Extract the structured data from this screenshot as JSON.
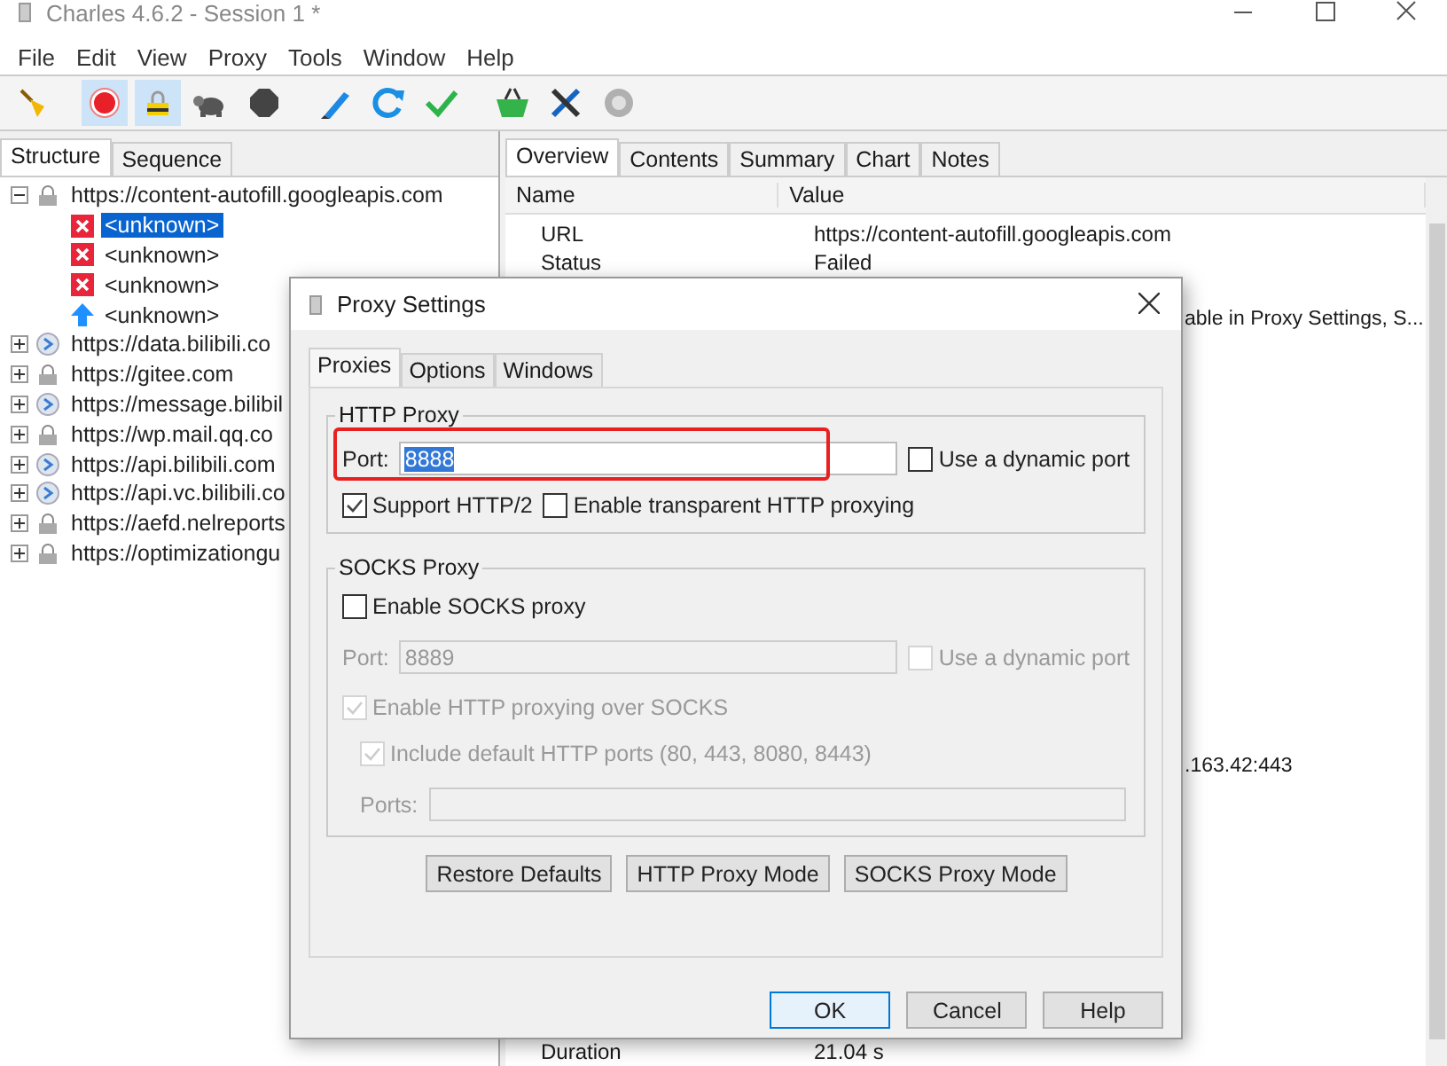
{
  "window": {
    "title": "Charles 4.6.2 - Session 1 *"
  },
  "menu": [
    "File",
    "Edit",
    "View",
    "Proxy",
    "Tools",
    "Window",
    "Help"
  ],
  "toolbar": [
    {
      "kind": "broom",
      "on": false
    },
    {
      "kind": "record",
      "on": true
    },
    {
      "kind": "throttle",
      "on": true
    },
    {
      "kind": "turtle",
      "on": false
    },
    {
      "kind": "stop",
      "on": false
    },
    {
      "kind": "pen",
      "on": false
    },
    {
      "kind": "refresh",
      "on": false
    },
    {
      "kind": "check",
      "on": false
    },
    {
      "kind": "basket",
      "on": false
    },
    {
      "kind": "tools",
      "on": false
    },
    {
      "kind": "gear",
      "on": false
    }
  ],
  "left_tabs": [
    {
      "label": "Structure",
      "selected": true
    },
    {
      "label": "Sequence",
      "selected": false
    }
  ],
  "tree": [
    {
      "label": "https://content-autofill.googleapis.com",
      "kind": "lock",
      "expanded": true,
      "children": [
        {
          "label": "<unknown>",
          "kind": "error",
          "selected": true
        },
        {
          "label": "<unknown>",
          "kind": "error",
          "selected": false
        },
        {
          "label": "<unknown>",
          "kind": "error",
          "selected": false
        },
        {
          "label": "<unknown>",
          "kind": "upload",
          "selected": false
        }
      ]
    },
    {
      "label": "https://data.bilibili.co",
      "kind": "globe",
      "expanded": false
    },
    {
      "label": "https://gitee.com",
      "kind": "lock",
      "expanded": false
    },
    {
      "label": "https://message.bilibil",
      "kind": "globe",
      "expanded": false
    },
    {
      "label": "https://wp.mail.qq.co",
      "kind": "lock",
      "expanded": false
    },
    {
      "label": "https://api.bilibili.com",
      "kind": "globe",
      "expanded": false
    },
    {
      "label": "https://api.vc.bilibili.co",
      "kind": "globe",
      "expanded": false
    },
    {
      "label": "https://aefd.nelreports",
      "kind": "lock",
      "expanded": false
    },
    {
      "label": "https://optimizationgu",
      "kind": "lock",
      "expanded": false
    }
  ],
  "right_tabs": [
    {
      "label": "Overview",
      "selected": true
    },
    {
      "label": "Contents",
      "selected": false
    },
    {
      "label": "Summary",
      "selected": false
    },
    {
      "label": "Chart",
      "selected": false
    },
    {
      "label": "Notes",
      "selected": false
    }
  ],
  "table": {
    "columns": [
      "Name",
      "Value"
    ],
    "rows": [
      {
        "kind": "full",
        "name": "URL",
        "value": "https://content-autofill.googleapis.com"
      },
      {
        "kind": "full",
        "name": "Status",
        "value": "Failed"
      },
      {
        "kind": "covered",
        "value": "able in Proxy Settings, S..."
      },
      {
        "kind": "covered",
        "value": ".163.42:443"
      },
      {
        "kind": "full",
        "name": "Duration",
        "value": "21.04 s"
      }
    ]
  },
  "dialog": {
    "title": "Proxy Settings",
    "tabs": [
      {
        "label": "Proxies",
        "selected": true
      },
      {
        "label": "Options",
        "selected": false
      },
      {
        "label": "Windows",
        "selected": false
      }
    ],
    "http": {
      "legend": "HTTP Proxy",
      "port_label": "Port:",
      "port": "8888",
      "dynamic": {
        "label": "Use a dynamic port",
        "checked": false
      },
      "options": [
        {
          "label": "Support HTTP/2",
          "checked": true
        },
        {
          "label": "Enable transparent HTTP proxying",
          "checked": false
        }
      ]
    },
    "socks": {
      "legend": "SOCKS Proxy",
      "enable": {
        "label": "Enable SOCKS proxy",
        "checked": false
      },
      "port_label": "Port:",
      "port": "8889",
      "port_disabled": true,
      "dynamic": {
        "label": "Use a dynamic port",
        "checked": false,
        "disabled": true
      },
      "http_over_socks": {
        "label": "Enable HTTP proxying over SOCKS",
        "checked": true,
        "disabled": true
      },
      "include_default": {
        "label": "Include default HTTP ports (80, 443, 8080, 8443)",
        "checked": true,
        "disabled": true
      },
      "ports_label": "Ports:",
      "ports_disabled": true
    },
    "mode_buttons": [
      "Restore Defaults",
      "HTTP Proxy Mode",
      "SOCKS Proxy Mode"
    ],
    "buttons": [
      {
        "label": "OK",
        "default": true
      },
      {
        "label": "Cancel",
        "default": false
      },
      {
        "label": "Help",
        "default": false
      }
    ]
  }
}
